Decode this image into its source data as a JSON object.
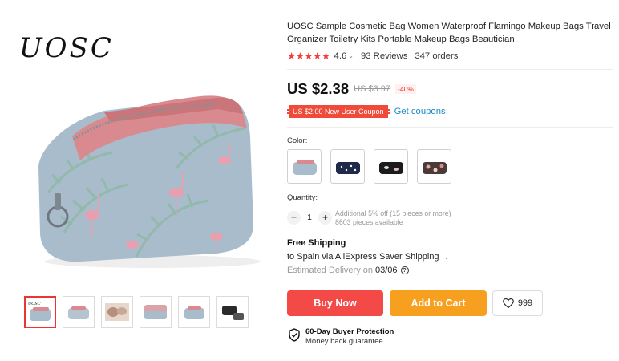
{
  "brand": {
    "logo_text": "UOSC"
  },
  "gallery": {
    "thumbnails": [
      {
        "name": "thumb-1",
        "active": true
      },
      {
        "name": "thumb-2",
        "active": false
      },
      {
        "name": "thumb-3",
        "active": false
      },
      {
        "name": "thumb-4",
        "active": false
      },
      {
        "name": "thumb-5",
        "active": false
      },
      {
        "name": "thumb-6",
        "active": false
      }
    ]
  },
  "product": {
    "title": "UOSC Sample Cosmetic Bag Women Waterproof Flamingo Makeup Bags Travel Organizer Toiletry Kits Portable Makeup Bags Beautician",
    "rating": "4.6",
    "reviews": "93 Reviews",
    "orders": "347 orders",
    "stars_icon": "star-icon",
    "star_color": "#f53c3c"
  },
  "price": {
    "current": "US $2.38",
    "original": "US $3.97",
    "discount": "-40%"
  },
  "coupon": {
    "tag": "US $2.00 New User Coupon",
    "link": "Get coupons"
  },
  "color": {
    "label": "Color:",
    "options": [
      "grey-flamingo",
      "navy-dots",
      "black-pattern",
      "pink-print"
    ]
  },
  "quantity": {
    "label": "Quantity:",
    "minus": "−",
    "plus": "+",
    "value": "1",
    "note_line1": "Additional 5% off (15 pieces or more)",
    "note_line2": "8603 pieces available"
  },
  "shipping": {
    "title": "Free Shipping",
    "destination": "to Spain via AliExpress Saver Shipping",
    "delivery_label": "Estimated Delivery on",
    "delivery_date": "03/06"
  },
  "actions": {
    "buy_now": "Buy Now",
    "add_to_cart": "Add to Cart",
    "wishlist_count": "999",
    "buy_color": "#f34a48",
    "cart_color": "#f7a020"
  },
  "protection": {
    "title": "60-Day Buyer Protection",
    "subtitle": "Money back guarantee"
  }
}
